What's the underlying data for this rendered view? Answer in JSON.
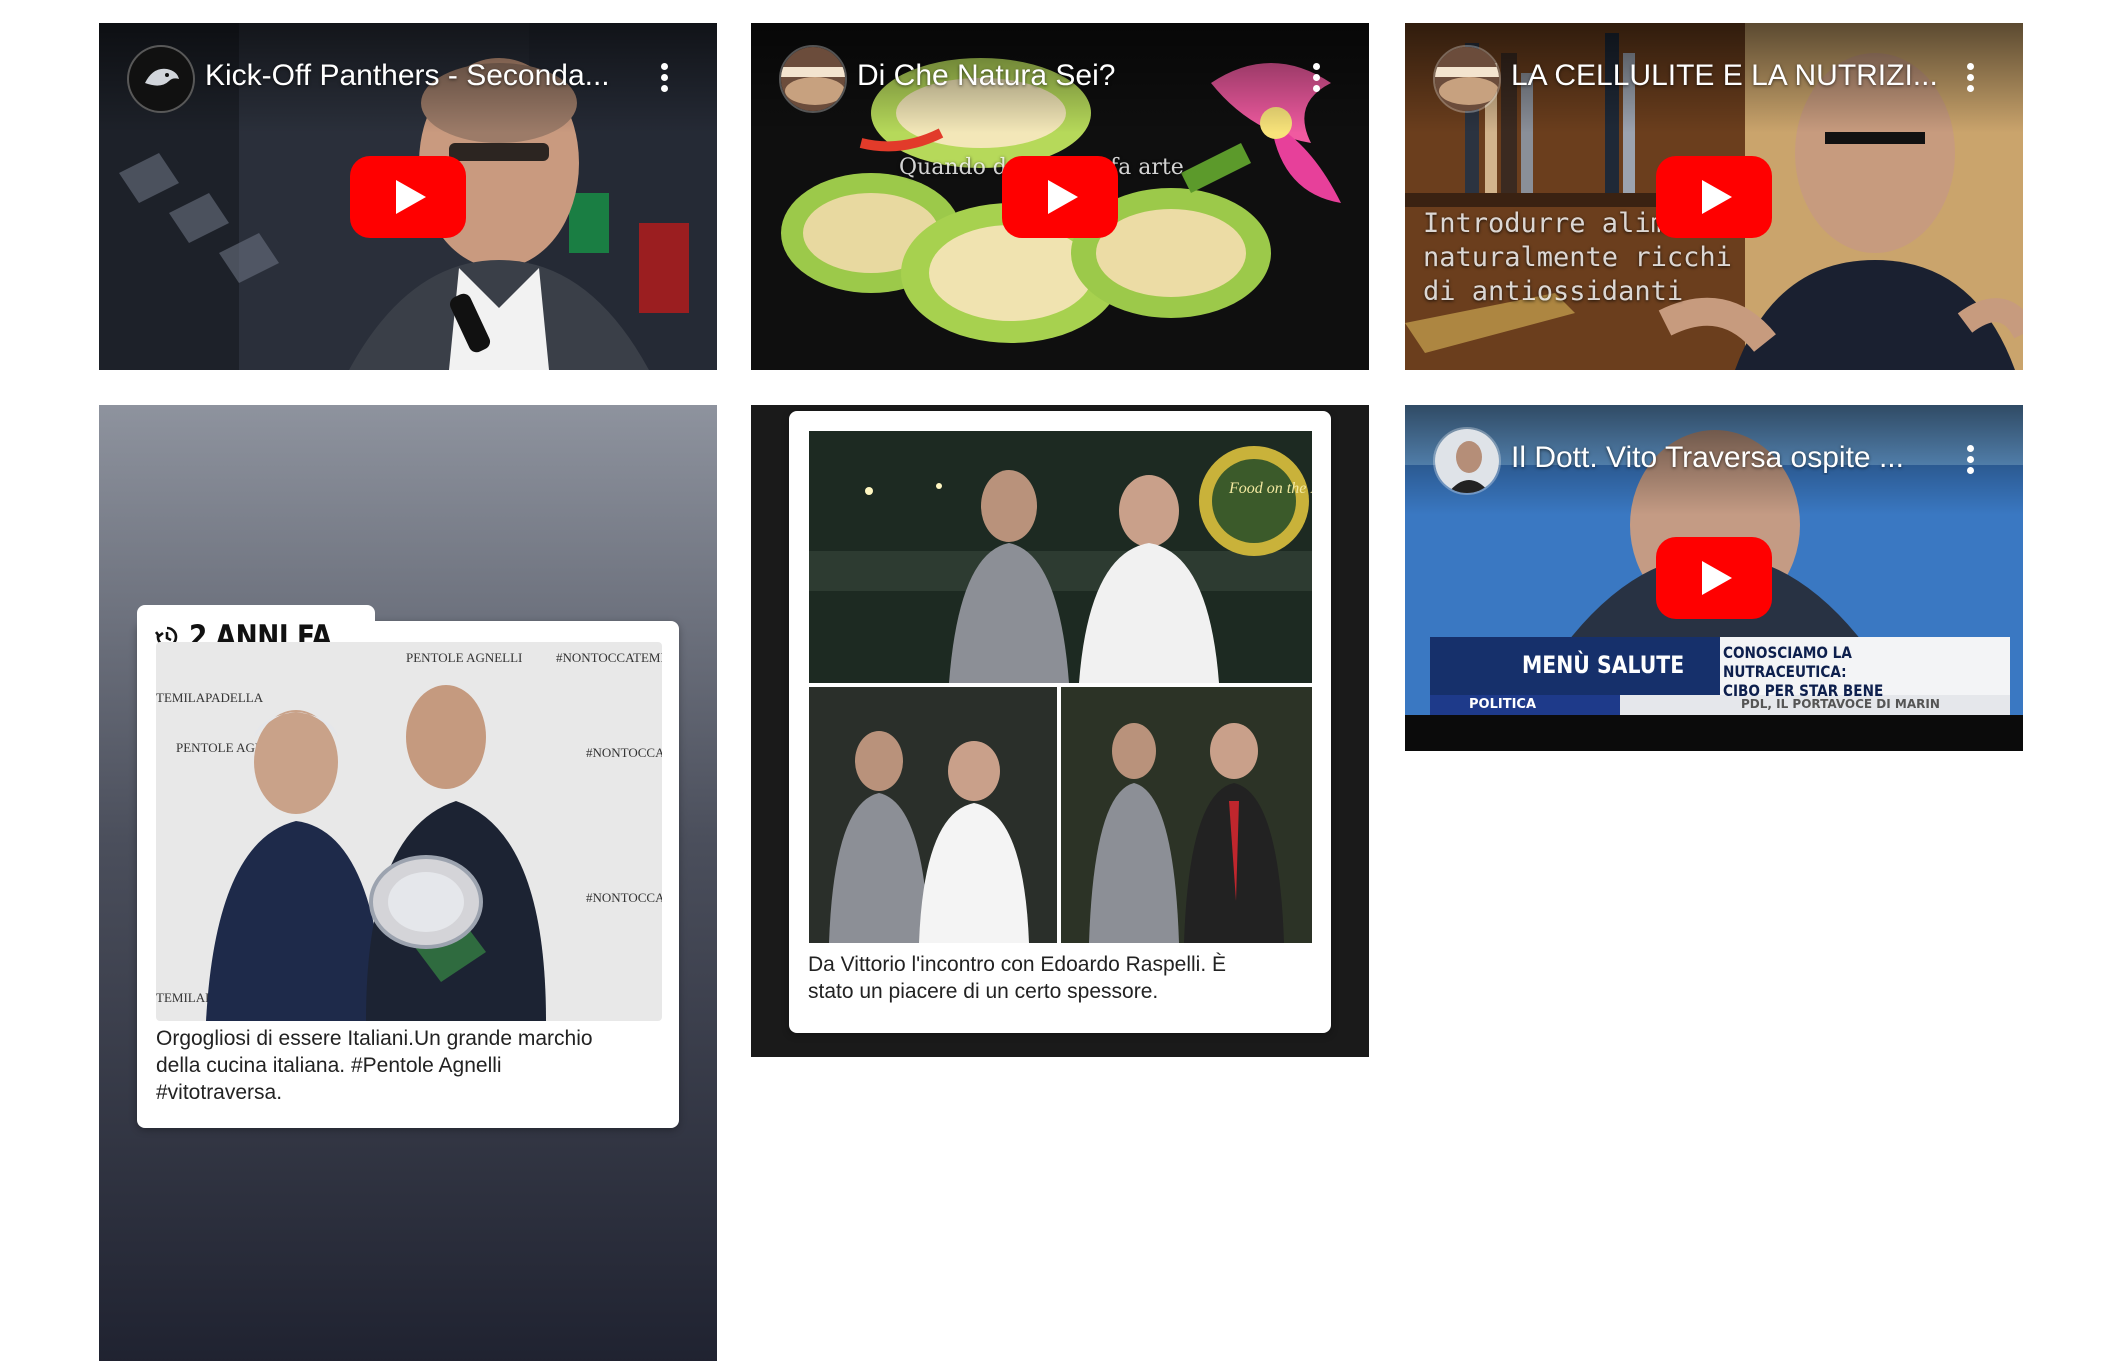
{
  "videos": [
    {
      "title": "Kick-Off Panthers - Seconda...",
      "channel_icon": "panther-logo-icon"
    },
    {
      "title": "Di Che Natura Sei?",
      "overlay": "Quando de        ne fa arte",
      "channel_icon": "channel-avatar-icon"
    },
    {
      "title": "LA CELLULITE E LA NUTRIZI...",
      "overlay_lines": [
        "Introdurre alime",
        "naturalmente ricchi",
        "di antiossidanti"
      ],
      "channel_icon": "channel-avatar-icon"
    },
    {
      "title": "Il Dott. Vito Traversa ospite ...",
      "channel_icon": "channel-avatar-icon",
      "tv": {
        "program": "MENÙ SALUTE",
        "headline_1": "CONOSCIAMO LA NUTRACEUTICA:",
        "headline_2": "CIBO PER STAR BENE",
        "section": "POLITICA",
        "ticker": "PDL, IL PORTAVOCE DI MARIN"
      }
    }
  ],
  "post1": {
    "badge": "2 ANNI FA",
    "caption_lines": [
      "Orgogliosi di essere  Italiani.Un grande marchio",
      "della cucina italiana. #Pentole Agnelli",
      "#vitotraversa."
    ],
    "backdrop_texts": [
      "#NONTOCCATEMILAPADELLA",
      "PENTOLE AGNELLI",
      "TEMILAPADELLA",
      "#NONTOCCA",
      "PENTOLE AGNELLI"
    ]
  },
  "post2": {
    "caption_lines": [
      "Da Vittorio l'incontro con Edoardo Raspelli. È",
      "stato un piacere di un certo spessore."
    ],
    "sign_text": "Food on the Road"
  },
  "colors": {
    "youtube_red": "#ff0000",
    "accent": "#e11d1d"
  }
}
